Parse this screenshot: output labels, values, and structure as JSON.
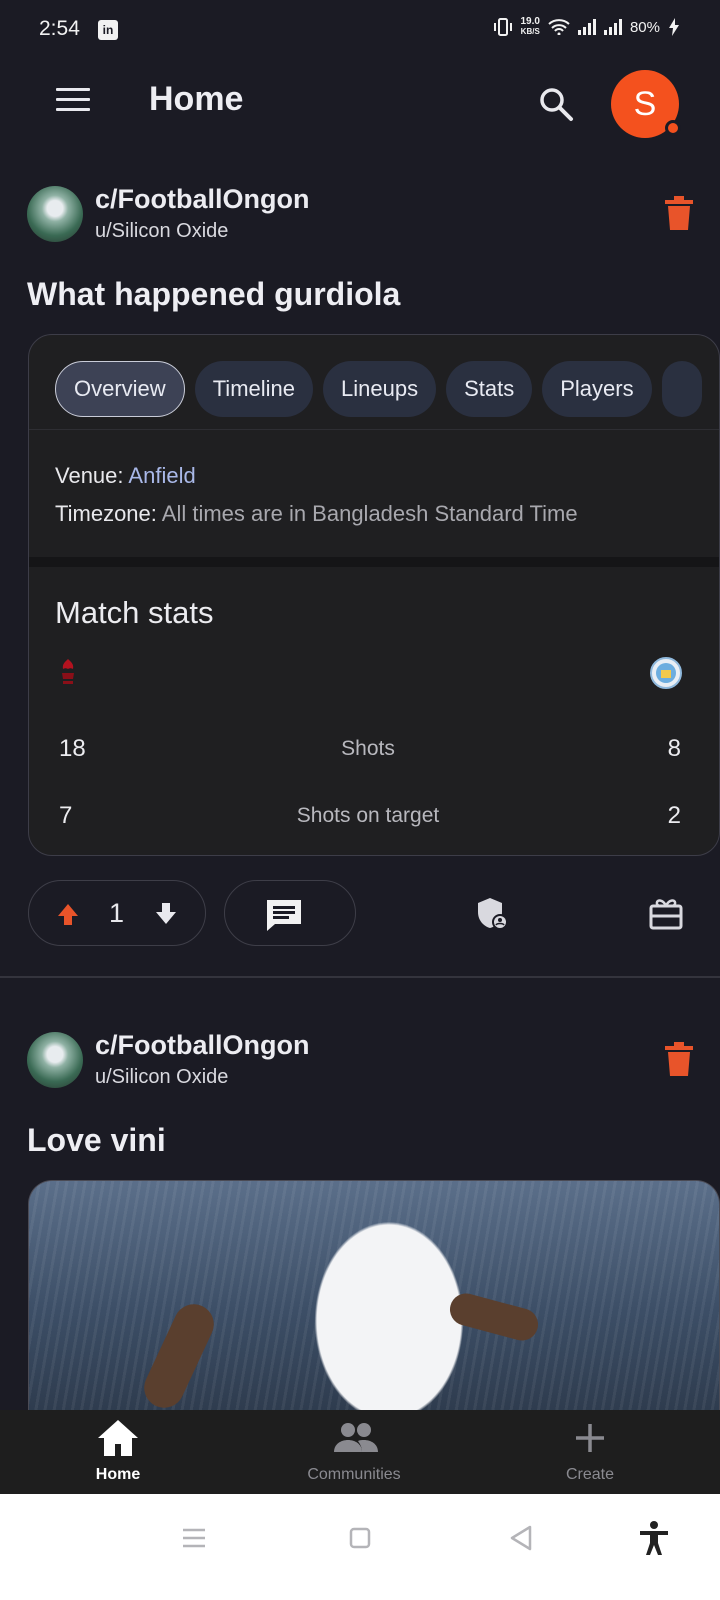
{
  "status_bar": {
    "time": "2:54",
    "app_badge": "in",
    "speed_value": "19.0",
    "speed_unit": "KB/S",
    "battery": "80%"
  },
  "app_bar": {
    "title": "Home",
    "avatar_letter": "S"
  },
  "posts": [
    {
      "community": "c/FootballOngon",
      "author": "u/Silicon Oxide",
      "title": "What happened gurdiola",
      "embed": {
        "tabs": [
          {
            "label": "Overview",
            "active": true
          },
          {
            "label": "Timeline",
            "active": false
          },
          {
            "label": "Lineups",
            "active": false
          },
          {
            "label": "Stats",
            "active": false
          },
          {
            "label": "Players",
            "active": false
          }
        ],
        "venue_label": "Venue:",
        "venue_value": "Anfield",
        "timezone_label": "Timezone:",
        "timezone_value": "All times are in Bangladesh Standard Time",
        "stats_title": "Match stats",
        "stats": [
          {
            "home": "18",
            "label": "Shots",
            "away": "8"
          },
          {
            "home": "7",
            "label": "Shots on target",
            "away": "2"
          }
        ]
      },
      "score": "1"
    },
    {
      "community": "c/FootballOngon",
      "author": "u/Silicon Oxide",
      "title": "Love vini"
    }
  ],
  "bottom_nav": [
    {
      "label": "Home",
      "icon": "home-icon",
      "active": true
    },
    {
      "label": "Communities",
      "icon": "people-icon",
      "active": false
    },
    {
      "label": "Create",
      "icon": "plus-icon",
      "active": false
    }
  ],
  "colors": {
    "accent": "#f4511e",
    "background": "#1b1b24",
    "link": "#a9b8e8"
  }
}
